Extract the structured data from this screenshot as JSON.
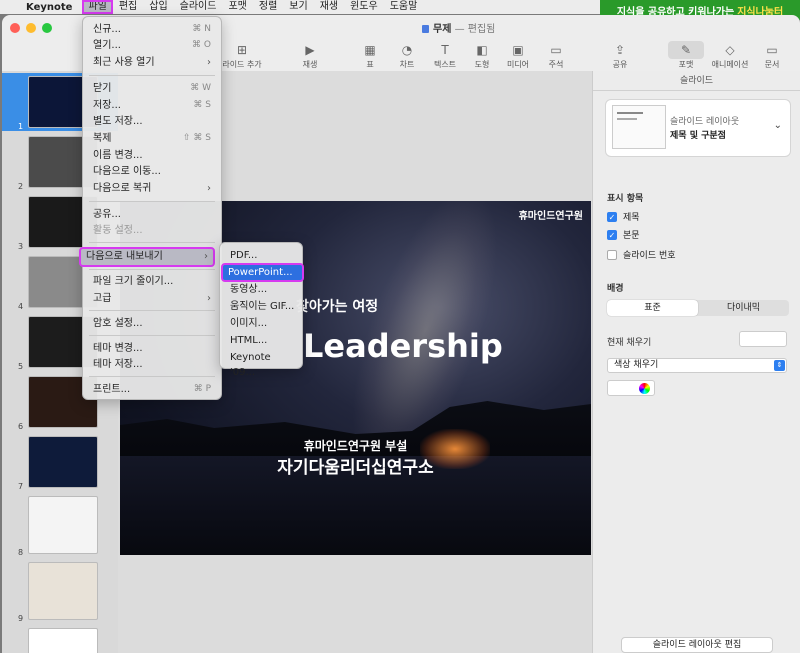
{
  "menubar": {
    "app": "Keynote",
    "items": [
      "파일",
      "편집",
      "삽입",
      "슬라이드",
      "포맷",
      "정렬",
      "보기",
      "재생",
      "윈도우",
      "도움말"
    ]
  },
  "banner": {
    "text": "지식을 공유하고 키워나가는",
    "highlight": "지식나눔터"
  },
  "window": {
    "title": "무제",
    "edited": "— 편집됨"
  },
  "toolbar": {
    "items": [
      {
        "label": "라이드 추가",
        "icon": "plus-square-icon"
      },
      {
        "label": "재생",
        "icon": "play-icon"
      },
      {
        "label": "표",
        "icon": "table-icon"
      },
      {
        "label": "차트",
        "icon": "chart-icon"
      },
      {
        "label": "텍스트",
        "icon": "text-icon"
      },
      {
        "label": "도형",
        "icon": "shape-icon"
      },
      {
        "label": "미디어",
        "icon": "media-icon"
      },
      {
        "label": "주석",
        "icon": "comment-icon"
      },
      {
        "label": "공유",
        "icon": "share-icon"
      },
      {
        "label": "포맷",
        "icon": "paintbrush-icon"
      },
      {
        "label": "애니메이션",
        "icon": "animate-icon"
      },
      {
        "label": "문서",
        "icon": "document-icon"
      }
    ]
  },
  "navigator": {
    "slides": [
      {
        "num": "1",
        "color": "#0c1638"
      },
      {
        "num": "2",
        "color": "#4b4b4b"
      },
      {
        "num": "3",
        "color": "#1a1a1a"
      },
      {
        "num": "4",
        "color": "#8a8a8a"
      },
      {
        "num": "5",
        "color": "#1c1c1c"
      },
      {
        "num": "6",
        "color": "#2a1a14"
      },
      {
        "num": "7",
        "color": "#0e1b3a"
      },
      {
        "num": "8",
        "color": "#f4f4f4"
      },
      {
        "num": "9",
        "color": "#e8e2d8"
      },
      {
        "num": "",
        "color": "#ffffff"
      }
    ]
  },
  "slide": {
    "brand": "휴마인드연구원",
    "subtitle": "찾아가는 여정",
    "title": "Leadership",
    "org1": "휴마인드연구원 부설",
    "org2": "자기다움리더십연구소"
  },
  "file_menu": {
    "items": [
      {
        "label": "신규...",
        "shortcut": "⌘ N"
      },
      {
        "label": "열기...",
        "shortcut": "⌘ O"
      },
      {
        "label": "최근 사용 열기",
        "submenu": true
      },
      {
        "label": "닫기",
        "shortcut": "⌘ W"
      },
      {
        "label": "저장...",
        "shortcut": "⌘ S"
      },
      {
        "label": "별도 저장..."
      },
      {
        "label": "복제",
        "shortcut": "⇧ ⌘ S"
      },
      {
        "label": "이름 변경..."
      },
      {
        "label": "다음으로 이동..."
      },
      {
        "label": "다음으로 복귀",
        "submenu": true
      },
      {
        "label": "공유..."
      },
      {
        "label": "활동 설정...",
        "disabled": true
      },
      {
        "label": "다음으로 내보내기",
        "submenu": true,
        "highlighted": true
      },
      {
        "label": "파일 크기 줄이기..."
      },
      {
        "label": "고급",
        "submenu": true
      },
      {
        "label": "암호 설정..."
      },
      {
        "label": "테마 변경..."
      },
      {
        "label": "테마 저장..."
      },
      {
        "label": "프린트...",
        "shortcut": "⌘ P"
      }
    ]
  },
  "export_menu": {
    "items": [
      {
        "label": "PDF..."
      },
      {
        "label": "PowerPoint...",
        "highlighted": true
      },
      {
        "label": "동영상..."
      },
      {
        "label": "움직이는 GIF..."
      },
      {
        "label": "이미지..."
      },
      {
        "label": "HTML..."
      },
      {
        "label": "Keynote '09..."
      }
    ]
  },
  "panel": {
    "title": "슬라이드",
    "layout_label": "슬라이드 레이아웃",
    "layout_value": "제목 및 구분점",
    "display_heading": "표시 항목",
    "checks": [
      {
        "label": "제목",
        "checked": true
      },
      {
        "label": "본문",
        "checked": true
      },
      {
        "label": "슬라이드 번호",
        "checked": false
      }
    ],
    "background_heading": "배경",
    "bg_tabs": [
      "표준",
      "다이내믹"
    ],
    "current_fill": "현재 채우기",
    "fill_select": "색상 채우기",
    "edit_layout": "슬라이드 레이아웃 편집"
  },
  "colors": {
    "menu_highlight_outline": "#d63af0",
    "selection_blue": "#2d6fe0",
    "banner_green": "#2a9a2a"
  }
}
